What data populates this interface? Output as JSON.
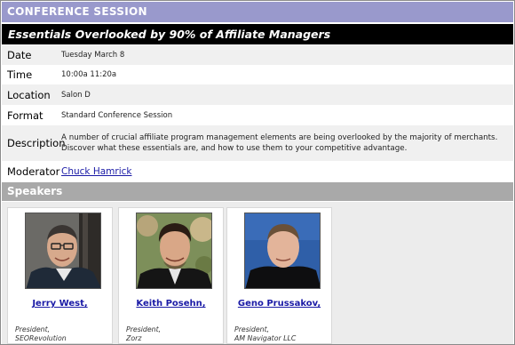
{
  "session": {
    "header": "CONFERENCE SESSION",
    "title": "Essentials Overlooked by 90% of Affiliate Managers"
  },
  "details": {
    "date": {
      "label": "Date",
      "value": "Tuesday March 8"
    },
    "time": {
      "label": "Time",
      "value": "10:00a 11:20a"
    },
    "location": {
      "label": "Location",
      "value": "Salon D"
    },
    "format": {
      "label": "Format",
      "value": "Standard Conference Session"
    },
    "description": {
      "label": "Description",
      "value": "A number of crucial affiliate program management elements are being overlooked by the majority of merchants. Discover what these essentials are, and how to use them to your competitive advantage."
    },
    "moderator": {
      "label": "Moderator",
      "value": "Chuck Hamrick"
    }
  },
  "speakers_header": "Speakers",
  "speakers": [
    {
      "name": "Jerry West,",
      "role": "President,",
      "company": "SEORevolution"
    },
    {
      "name": "Keith Posehn,",
      "role": "President,",
      "company": "Zorz"
    },
    {
      "name": "Geno Prussakov,",
      "role": "President,",
      "company": "AM Navigator LLC"
    }
  ],
  "colors": {
    "session_header_bg": "#9999cc",
    "title_bg": "#000000",
    "speakers_bar_bg": "#a9a9a9",
    "link": "#1a1aa6"
  }
}
